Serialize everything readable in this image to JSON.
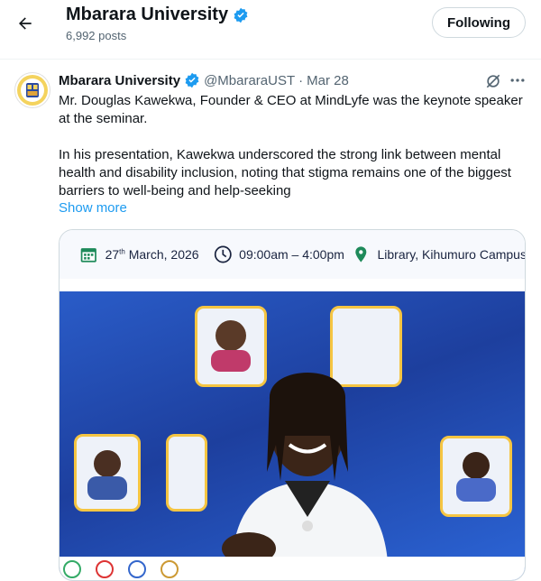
{
  "header": {
    "title": "Mbarara University",
    "posts": "6,992 posts",
    "follow_label": "Following"
  },
  "tweet": {
    "name": "Mbarara University",
    "handle": "@MbararaUST",
    "separator": "·",
    "date": "Mar 28",
    "text": "Mr. Douglas Kawekwa, Founder & CEO at MindLyfe was the keynote speaker at the seminar.\n\nIn his presentation, Kawekwa underscored the strong link between mental health and disability inclusion, noting that stigma remains one of the biggest barriers to well-being and help-seeking",
    "show_more": "Show more"
  },
  "media": {
    "date_day": "27",
    "date_sup": "th",
    "date_rest": " March, 2026",
    "time": "09:00am – 4:00pm",
    "location": "Library, Kihumuro Campus"
  },
  "colors": {
    "verified": "#1d9bf0",
    "poster_blue": "#2a5cc8",
    "card_border": "#f5c542"
  }
}
